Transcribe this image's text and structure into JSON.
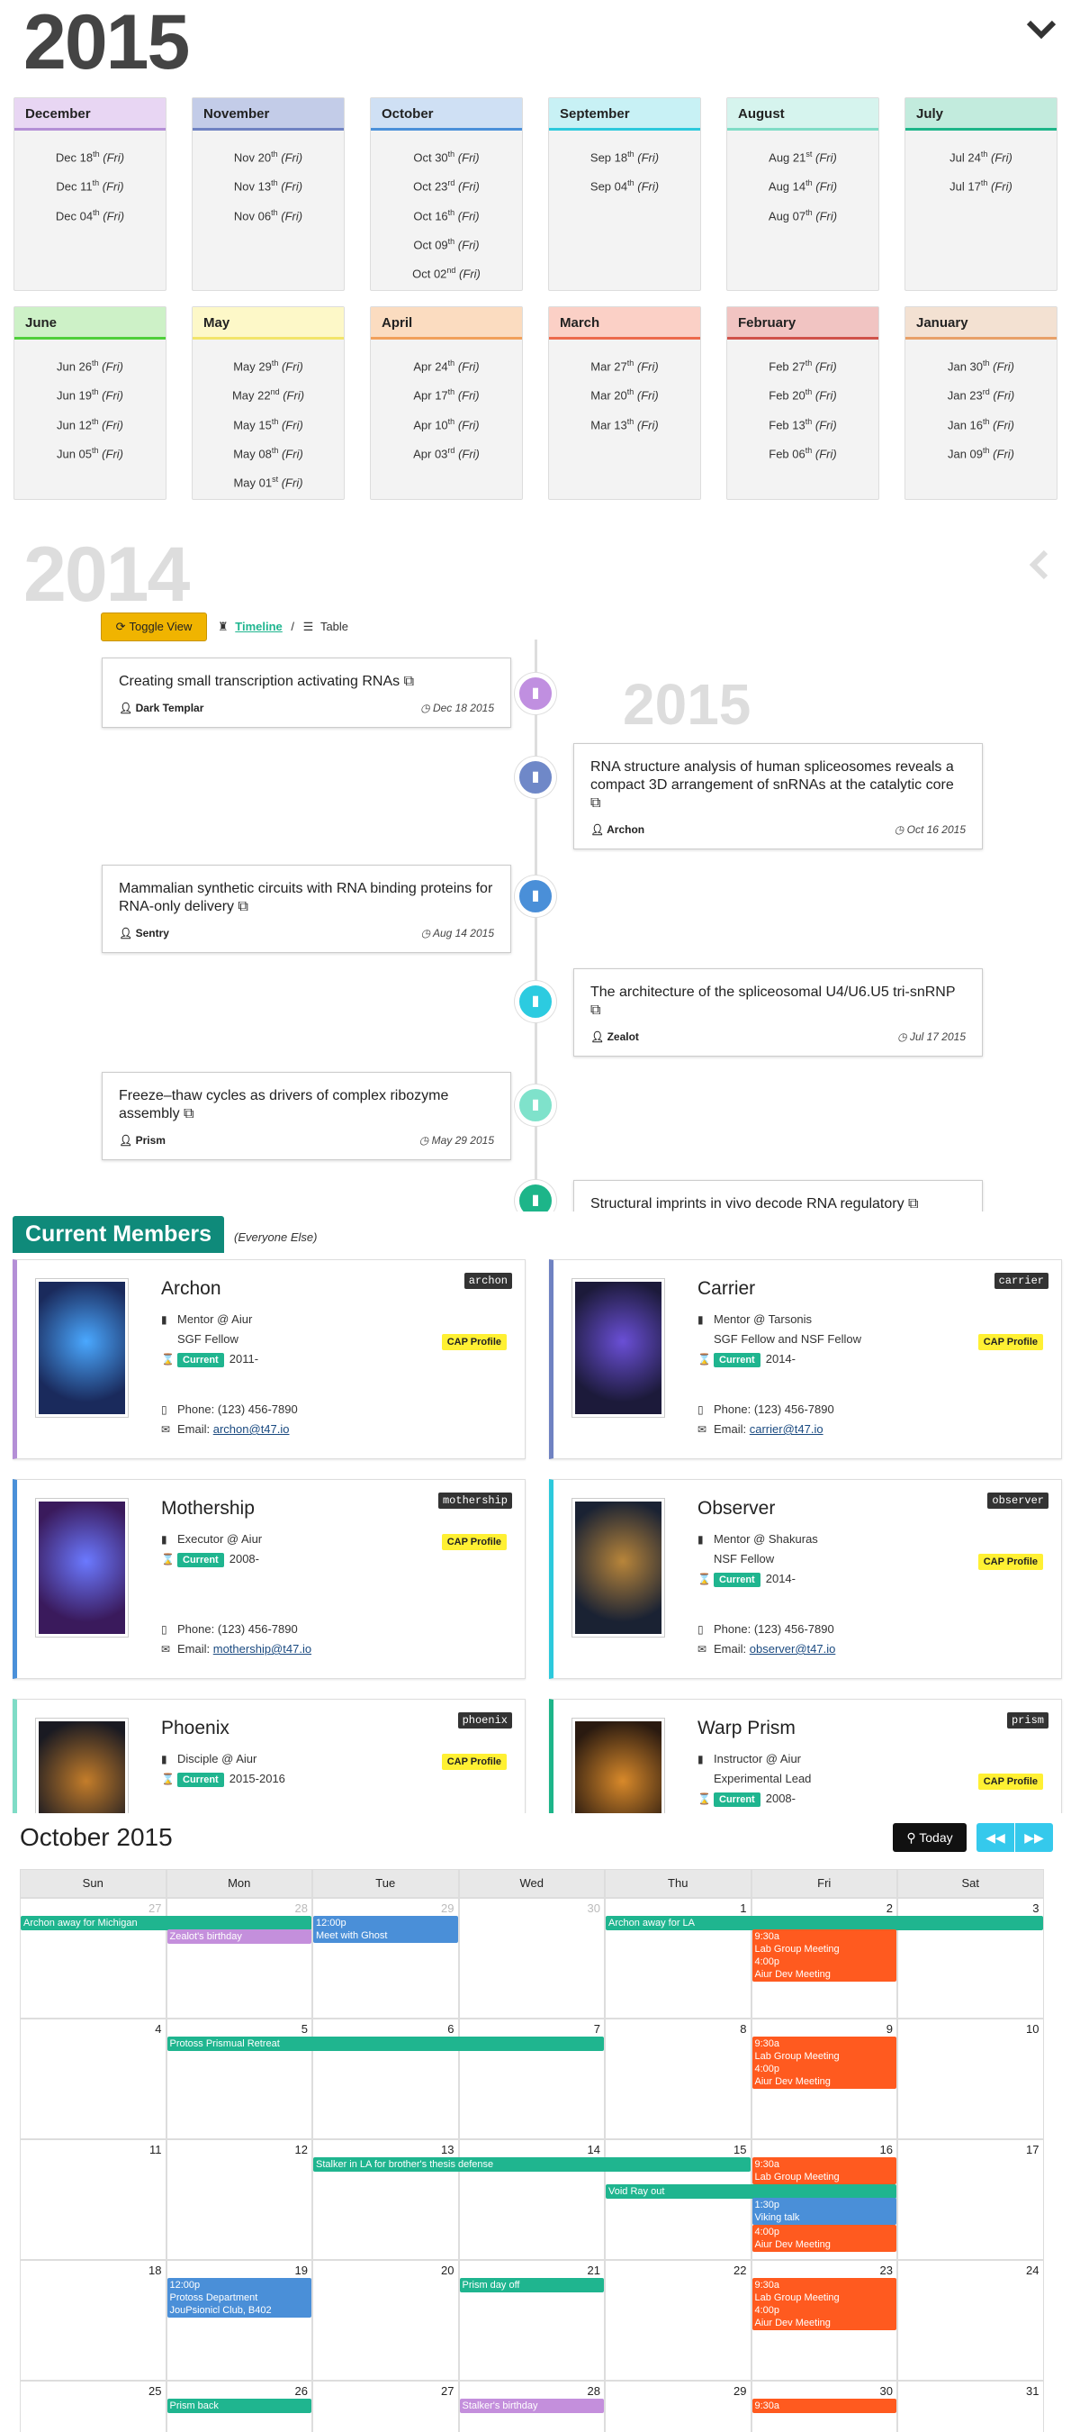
{
  "header": {
    "year_2015": "2015",
    "year_2014": "2014",
    "watermark": "2015"
  },
  "months": [
    {
      "name": "December",
      "color": "#e8d6f3",
      "line": "#b48fd6",
      "dates": [
        [
          "Dec 18",
          "th"
        ],
        [
          "Dec 11",
          "th"
        ],
        [
          "Dec 04",
          "th"
        ]
      ]
    },
    {
      "name": "November",
      "color": "#c3cce8",
      "line": "#6f82c2",
      "dates": [
        [
          "Nov 20",
          "th"
        ],
        [
          "Nov 13",
          "th"
        ],
        [
          "Nov 06",
          "th"
        ]
      ]
    },
    {
      "name": "October",
      "color": "#cfe0f4",
      "line": "#4a90d9",
      "dates": [
        [
          "Oct 30",
          "th"
        ],
        [
          "Oct 23",
          "rd"
        ],
        [
          "Oct 16",
          "th"
        ],
        [
          "Oct 09",
          "th"
        ],
        [
          "Oct 02",
          "nd"
        ]
      ]
    },
    {
      "name": "September",
      "color": "#c8f1f5",
      "line": "#2cc9dc",
      "dates": [
        [
          "Sep 18",
          "th"
        ],
        [
          "Sep 04",
          "th"
        ]
      ]
    },
    {
      "name": "August",
      "color": "#d6f4ee",
      "line": "#7fdcc6",
      "dates": [
        [
          "Aug 21",
          "st"
        ],
        [
          "Aug 14",
          "th"
        ],
        [
          "Aug 07",
          "th"
        ]
      ]
    },
    {
      "name": "July",
      "color": "#c2ebdd",
      "line": "#1db589",
      "dates": [
        [
          "Jul 24",
          "th"
        ],
        [
          "Jul 17",
          "th"
        ]
      ]
    },
    {
      "name": "June",
      "color": "#cdf1c7",
      "line": "#4fcf3a",
      "dates": [
        [
          "Jun 26",
          "th"
        ],
        [
          "Jun 19",
          "th"
        ],
        [
          "Jun 12",
          "th"
        ],
        [
          "Jun 05",
          "th"
        ]
      ]
    },
    {
      "name": "May",
      "color": "#fdf8c8",
      "line": "#f2e56a",
      "dates": [
        [
          "May 29",
          "th"
        ],
        [
          "May 22",
          "nd"
        ],
        [
          "May 15",
          "th"
        ],
        [
          "May 08",
          "th"
        ],
        [
          "May 01",
          "st"
        ]
      ]
    },
    {
      "name": "April",
      "color": "#fbdcc0",
      "line": "#f1a05a",
      "dates": [
        [
          "Apr 24",
          "th"
        ],
        [
          "Apr 17",
          "th"
        ],
        [
          "Apr 10",
          "th"
        ],
        [
          "Apr 03",
          "rd"
        ]
      ]
    },
    {
      "name": "March",
      "color": "#fbd0c6",
      "line": "#ec6a4c",
      "dates": [
        [
          "Mar 27",
          "th"
        ],
        [
          "Mar 20",
          "th"
        ],
        [
          "Mar 13",
          "th"
        ]
      ]
    },
    {
      "name": "February",
      "color": "#f1c4c2",
      "line": "#d0524a",
      "dates": [
        [
          "Feb 27",
          "th"
        ],
        [
          "Feb 20",
          "th"
        ],
        [
          "Feb 13",
          "th"
        ],
        [
          "Feb 06",
          "th"
        ]
      ]
    },
    {
      "name": "January",
      "color": "#f3e1d2",
      "line": "#e8a068",
      "dates": [
        [
          "Jan 30",
          "th"
        ],
        [
          "Jan 23",
          "rd"
        ],
        [
          "Jan 16",
          "th"
        ],
        [
          "Jan 09",
          "th"
        ]
      ]
    }
  ],
  "fri": "(Fri)",
  "toolbar": {
    "toggle": "Toggle View",
    "timeline": "Timeline",
    "sep": "/",
    "table": "Table"
  },
  "timeline": [
    {
      "title": "Creating small transcription activating RNAs",
      "author": "Dark Templar",
      "date": "Dec 18 2015",
      "color": "#c08fe0"
    },
    {
      "title": "RNA structure analysis of human spliceosomes reveals a compact 3D arrangement of snRNAs at the catalytic core",
      "author": "Archon",
      "date": "Oct 16 2015",
      "color": "#6f88c8"
    },
    {
      "title": "Mammalian synthetic circuits with RNA binding proteins for RNA-only delivery",
      "author": "Sentry",
      "date": "Aug 14 2015",
      "color": "#4a8fd8"
    },
    {
      "title": "The architecture of the spliceosomal U4/U6.U5 tri-snRNP",
      "author": "Zealot",
      "date": "Jul 17 2015",
      "color": "#2ccbe0"
    },
    {
      "title": "Freeze–thaw cycles as drivers of complex ribozyme assembly",
      "author": "Prism",
      "date": "May 29 2015",
      "color": "#7fe2cb"
    },
    {
      "title": "Structural imprints in vivo decode RNA regulatory",
      "author": "",
      "date": "",
      "color": "#1db589"
    }
  ],
  "members_section": {
    "title": "Current Members",
    "subtitle": "(Everyone Else)"
  },
  "members": [
    {
      "name": "Archon",
      "tag": "archon",
      "role": "Mentor @ Aiur",
      "fellow": "SGF Fellow",
      "status": "Current",
      "years": "2011-",
      "cap": "CAP Profile",
      "phone_label": "Phone:",
      "phone": "(123) 456-7890",
      "email_label": "Email:",
      "email": "archon@t47.io",
      "border": "#b48fd6"
    },
    {
      "name": "Carrier",
      "tag": "carrier",
      "role": "Mentor @ Tarsonis",
      "fellow": "SGF Fellow and NSF Fellow",
      "status": "Current",
      "years": "2014-",
      "cap": "CAP Profile",
      "phone_label": "Phone:",
      "phone": "(123) 456-7890",
      "email_label": "Email:",
      "email": "carrier@t47.io",
      "border": "#6f82c2"
    },
    {
      "name": "Mothership",
      "tag": "mothership",
      "role": "Executor @ Aiur",
      "fellow": "",
      "status": "Current",
      "years": "2008-",
      "cap": "CAP Profile",
      "phone_label": "Phone:",
      "phone": "(123) 456-7890",
      "email_label": "Email:",
      "email": "mothership@t47.io",
      "border": "#4a90d9"
    },
    {
      "name": "Observer",
      "tag": "observer",
      "role": "Mentor @ Shakuras",
      "fellow": "NSF Fellow",
      "status": "Current",
      "years": "2014-",
      "cap": "CAP Profile",
      "phone_label": "Phone:",
      "phone": "(123) 456-7890",
      "email_label": "Email:",
      "email": "observer@t47.io",
      "border": "#2cc9dc"
    },
    {
      "name": "Phoenix",
      "tag": "phoenix",
      "role": "Disciple @ Aiur",
      "fellow": "",
      "status": "Current",
      "years": "2015-2016",
      "cap": "CAP Profile",
      "phone_label": "",
      "phone": "",
      "email_label": "",
      "email": "",
      "border": "#7fdcc6"
    },
    {
      "name": "Warp Prism",
      "tag": "prism",
      "role": "Instructor @ Aiur",
      "fellow": "Experimental Lead",
      "status": "Current",
      "years": "2008-",
      "cap": "CAP Profile",
      "phone_label": "",
      "phone": "",
      "email_label": "",
      "email": "",
      "border": "#1db589"
    }
  ],
  "calendar": {
    "title": "October 2015",
    "today": "Today",
    "days": [
      "Sun",
      "Mon",
      "Tue",
      "Wed",
      "Thu",
      "Fri",
      "Sat"
    ],
    "weeks": [
      [
        "27",
        "28",
        "29",
        "30",
        "1",
        "2",
        "3"
      ],
      [
        "4",
        "5",
        "6",
        "7",
        "8",
        "9",
        "10"
      ],
      [
        "11",
        "12",
        "13",
        "14",
        "15",
        "16",
        "17"
      ],
      [
        "18",
        "19",
        "20",
        "21",
        "22",
        "23",
        "24"
      ],
      [
        "25",
        "26",
        "27",
        "28",
        "29",
        "30",
        "31"
      ]
    ],
    "events": [
      {
        "w": 0,
        "c": 0,
        "span": 2,
        "row": 0,
        "text": "Archon away for Michigan",
        "color": "#1fb58f"
      },
      {
        "w": 0,
        "c": 1,
        "span": 1,
        "row": 1,
        "text": "Zealot's birthday",
        "color": "#c48fdc"
      },
      {
        "w": 0,
        "c": 2,
        "span": 1,
        "row": 0,
        "text": "12:00p",
        "color": "#4a8fd8",
        "lines": 2,
        "text2": "Meet with Ghost"
      },
      {
        "w": 0,
        "c": 4,
        "span": 3,
        "row": 0,
        "text": "Archon away for LA",
        "color": "#1fb58f"
      },
      {
        "w": 0,
        "c": 5,
        "span": 1,
        "row": 1,
        "text": "9:30a",
        "color": "#ff5a1f",
        "lines": 4,
        "text2": "Lab Group Meeting",
        "text3": "4:00p",
        "text4": "Aiur Dev Meeting"
      },
      {
        "w": 1,
        "c": 1,
        "span": 3,
        "row": 0,
        "text": "Protoss Prismual Retreat",
        "color": "#1fb58f"
      },
      {
        "w": 1,
        "c": 5,
        "span": 1,
        "row": 0,
        "text": "9:30a",
        "color": "#ff5a1f",
        "lines": 4,
        "text2": "Lab Group Meeting",
        "text3": "4:00p",
        "text4": "Aiur Dev Meeting"
      },
      {
        "w": 2,
        "c": 2,
        "span": 3,
        "row": 0,
        "text": "Stalker in LA for brother's thesis defense",
        "color": "#1fb58f"
      },
      {
        "w": 2,
        "c": 4,
        "span": 2,
        "row": 2,
        "text": "Void Ray out",
        "color": "#1fb58f"
      },
      {
        "w": 2,
        "c": 5,
        "span": 1,
        "row": 0,
        "text": "9:30a",
        "color": "#ff5a1f",
        "lines": 2,
        "text2": "Lab Group Meeting"
      },
      {
        "w": 2,
        "c": 5,
        "span": 1,
        "row": 3,
        "text": "1:30p",
        "color": "#4a8fd8",
        "lines": 2,
        "text2": "Viking talk"
      },
      {
        "w": 2,
        "c": 5,
        "span": 1,
        "row": 5,
        "text": "4:00p",
        "color": "#ff5a1f",
        "lines": 2,
        "text2": "Aiur Dev Meeting"
      },
      {
        "w": 3,
        "c": 1,
        "span": 1,
        "row": 0,
        "text": "12:00p",
        "color": "#4a8fd8",
        "lines": 3,
        "text2": "Protoss Department",
        "text3": "JouPsionicl Club, B402"
      },
      {
        "w": 3,
        "c": 3,
        "span": 1,
        "row": 0,
        "text": "Prism day off",
        "color": "#1fb58f"
      },
      {
        "w": 3,
        "c": 5,
        "span": 1,
        "row": 0,
        "text": "9:30a",
        "color": "#ff5a1f",
        "lines": 4,
        "text2": "Lab Group Meeting",
        "text3": "4:00p",
        "text4": "Aiur Dev Meeting"
      },
      {
        "w": 4,
        "c": 1,
        "span": 1,
        "row": 0,
        "text": "Prism back",
        "color": "#1fb58f"
      },
      {
        "w": 4,
        "c": 3,
        "span": 1,
        "row": 0,
        "text": "Stalker's birthday",
        "color": "#c48fdc"
      },
      {
        "w": 4,
        "c": 5,
        "span": 1,
        "row": 0,
        "text": "9:30a",
        "color": "#ff5a1f"
      }
    ]
  }
}
